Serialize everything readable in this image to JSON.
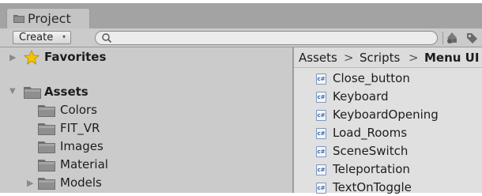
{
  "window": {
    "tab_label": "Project"
  },
  "toolbar": {
    "create_label": "Create",
    "create_caret": "▾",
    "search_value": "",
    "icons": [
      "search-icon",
      "filter-by-type-icon",
      "filter-by-label-icon"
    ]
  },
  "tree": {
    "favorites": {
      "label": "Favorites",
      "expanded": false
    },
    "assets": {
      "label": "Assets",
      "expanded": true,
      "children": [
        {
          "label": "Colors",
          "has_children": false
        },
        {
          "label": "FIT_VR",
          "has_children": false
        },
        {
          "label": "Images",
          "has_children": false
        },
        {
          "label": "Material",
          "has_children": false
        },
        {
          "label": "Models",
          "has_children": true
        }
      ]
    }
  },
  "breadcrumb": {
    "parts": [
      "Assets",
      "Scripts",
      "Menu UI"
    ],
    "separator": ">"
  },
  "files": {
    "type_badge": "c#",
    "items": [
      "Close_button",
      "Keyboard",
      "KeyboardOpening",
      "Load_Rooms",
      "SceneSwitch",
      "Teleportation",
      "TextOnToggle"
    ]
  },
  "colors": {
    "tab_strip": "#a3a3a3",
    "left_panel": "#cbcbcb",
    "right_panel": "#e0e0e0",
    "star": "#f4c400",
    "folder": "#8c8c8c"
  }
}
